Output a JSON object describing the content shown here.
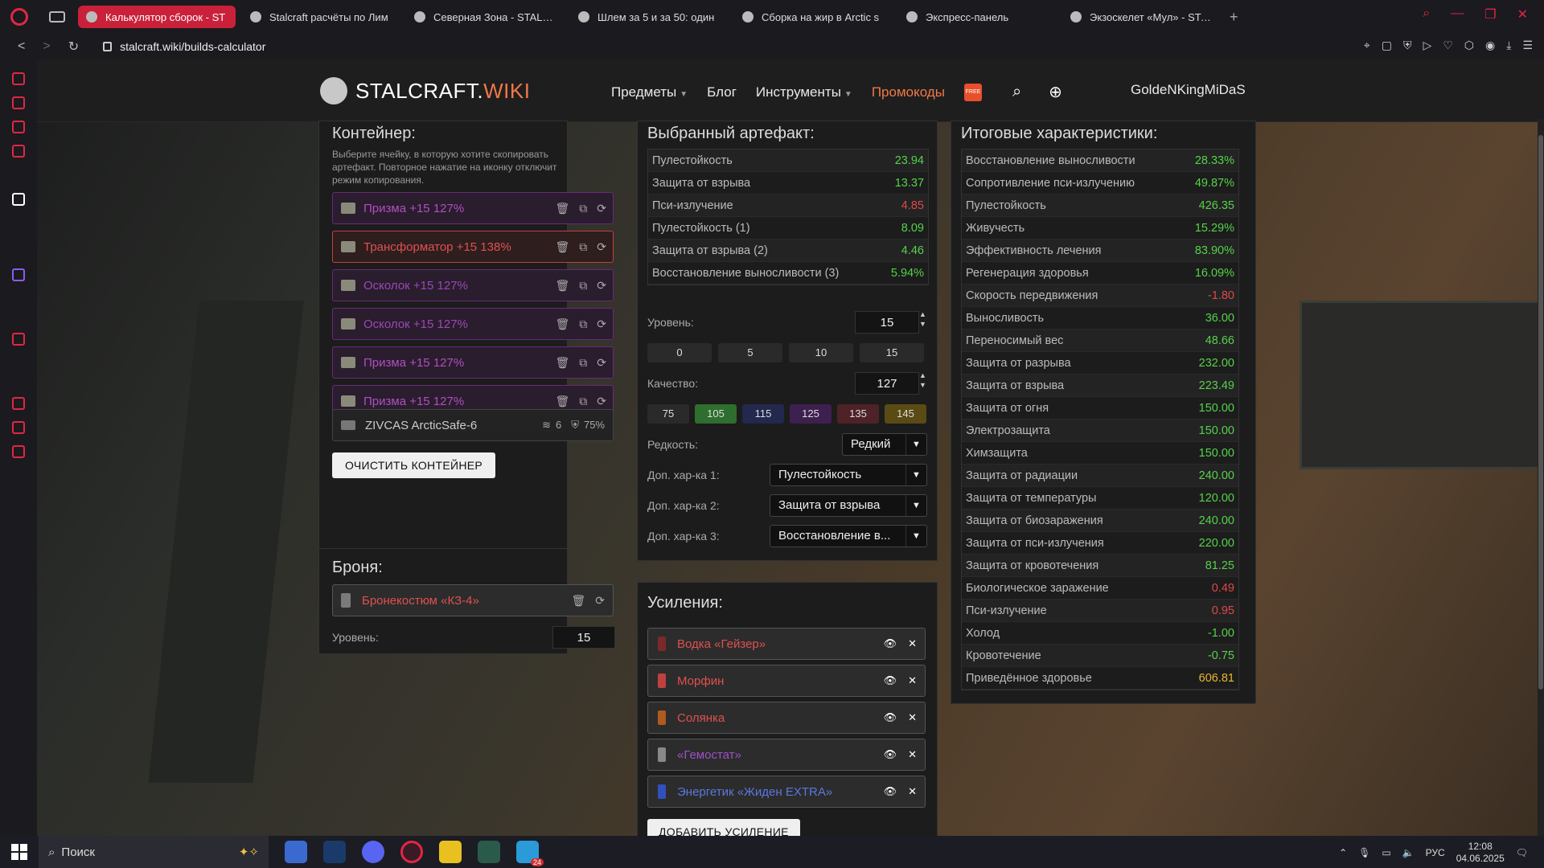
{
  "browser": {
    "tabs": [
      {
        "label": "Калькулятор сборок - ST",
        "active": true
      },
      {
        "label": "Stalcraft расчёты по Лим"
      },
      {
        "label": "Северная Зона - STALCR"
      },
      {
        "label": "Шлем за 5 и за 50: один"
      },
      {
        "label": "Сборка на жир в Arctic s"
      },
      {
        "label": "Экспресс-панель"
      },
      {
        "label": "Экзоскелет «Мул» - STAL"
      }
    ],
    "url": "stalcraft.wiki/builds-calculator",
    "accent": "#e02744"
  },
  "site": {
    "logo_main": "STALCRAFT.",
    "logo_accent": "WIKI",
    "menu": {
      "items": "Предметы",
      "blog": "Блог",
      "tools": "Инструменты",
      "promo": "Промокоды",
      "free_badge": "FREE"
    },
    "user": "GoldeNKingMiDaS"
  },
  "container": {
    "title": "Контейнер:",
    "hint": "Выберите ячейку, в которую хотите скопировать артефакт. Повторное нажатие на иконку отключит режим копирования.",
    "slots": [
      {
        "label": "Призма +15 127%"
      },
      {
        "label": "Трансформатор +15 138%"
      },
      {
        "label": "Осколок +15 127%"
      },
      {
        "label": "Осколок +15 127%"
      },
      {
        "label": "Призма +15 127%"
      },
      {
        "label": "Призма +15 127%"
      }
    ],
    "item": {
      "name": "ZIVCAS ArcticSafe-6",
      "slots": "6",
      "protection": "75%"
    },
    "clear_button": "ОЧИСТИТЬ КОНТЕЙНЕР"
  },
  "armor": {
    "title": "Броня:",
    "item": "Бронекостюм «КЗ-4»",
    "level_label": "Уровень:",
    "level": "15"
  },
  "artifact": {
    "title": "Выбранный артефакт:",
    "stats": [
      {
        "name": "Пулестойкость",
        "value": "23.94",
        "color": "g"
      },
      {
        "name": "Защита от взрыва",
        "value": "13.37",
        "color": "g"
      },
      {
        "name": "Пси-излучение",
        "value": "4.85",
        "color": "r"
      },
      {
        "name": "Пулестойкость (1)",
        "value": "8.09",
        "color": "g"
      },
      {
        "name": "Защита от взрыва (2)",
        "value": "4.46",
        "color": "g"
      },
      {
        "name": "Восстановление выносливости (3)",
        "value": "5.94%",
        "color": "g"
      }
    ],
    "level_label": "Уровень:",
    "level": "15",
    "level_quick": [
      "0",
      "5",
      "10",
      "15"
    ],
    "quality_label": "Качество:",
    "quality": "127",
    "quality_quick": [
      "75",
      "105",
      "115",
      "125",
      "135",
      "145"
    ],
    "quality_colors": [
      "#2a2a2a",
      "#2e6e2e",
      "#22284e",
      "#3e2050",
      "#4e2226",
      "#5a4a14"
    ],
    "rarity_label": "Редкость:",
    "rarity": "Редкий",
    "extra1_label": "Доп. хар-ка 1:",
    "extra1": "Пулестойкость",
    "extra2_label": "Доп. хар-ка 2:",
    "extra2": "Защита от взрыва",
    "extra3_label": "Доп. хар-ка 3:",
    "extra3": "Восстановление в..."
  },
  "boosts": {
    "title": "Усиления:",
    "items": [
      {
        "name": "Водка «Гейзер»",
        "color": "#e05050",
        "icon": "#7a2a2a"
      },
      {
        "name": "Морфин",
        "color": "#e05050",
        "icon": "#c04040"
      },
      {
        "name": "Солянка",
        "color": "#e05050",
        "icon": "#b05a20"
      },
      {
        "name": "«Гемостат»",
        "color": "#a050c8",
        "icon": "#888"
      },
      {
        "name": "Энергетик «Жиден EXTRA»",
        "color": "#5a78e0",
        "icon": "#3050c0"
      }
    ],
    "add_button": "ДОБАВИТЬ УСИЛЕНИЕ"
  },
  "total": {
    "title": "Итоговые характеристики:",
    "stats": [
      {
        "name": "Восстановление выносливости",
        "value": "28.33%",
        "color": "g"
      },
      {
        "name": "Сопротивление пси-излучению",
        "value": "49.87%",
        "color": "g"
      },
      {
        "name": "Пулестойкость",
        "value": "426.35",
        "color": "g"
      },
      {
        "name": "Живучесть",
        "value": "15.29%",
        "color": "g"
      },
      {
        "name": "Эффективность лечения",
        "value": "83.90%",
        "color": "g"
      },
      {
        "name": "Регенерация здоровья",
        "value": "16.09%",
        "color": "g"
      },
      {
        "name": "Скорость передвижения",
        "value": "-1.80",
        "color": "r"
      },
      {
        "name": "Выносливость",
        "value": "36.00",
        "color": "g"
      },
      {
        "name": "Переносимый вес",
        "value": "48.66",
        "color": "g"
      },
      {
        "name": "Защита от разрыва",
        "value": "232.00",
        "color": "g"
      },
      {
        "name": "Защита от взрыва",
        "value": "223.49",
        "color": "g"
      },
      {
        "name": "Защита от огня",
        "value": "150.00",
        "color": "g"
      },
      {
        "name": "Электрозащита",
        "value": "150.00",
        "color": "g"
      },
      {
        "name": "Химзащита",
        "value": "150.00",
        "color": "g"
      },
      {
        "name": "Защита от радиации",
        "value": "240.00",
        "color": "g"
      },
      {
        "name": "Защита от температуры",
        "value": "120.00",
        "color": "g"
      },
      {
        "name": "Защита от биозаражения",
        "value": "240.00",
        "color": "g"
      },
      {
        "name": "Защита от пси-излучения",
        "value": "220.00",
        "color": "g"
      },
      {
        "name": "Защита от кровотечения",
        "value": "81.25",
        "color": "g"
      },
      {
        "name": "Биологическое заражение",
        "value": "0.49",
        "color": "r"
      },
      {
        "name": "Пси-излучение",
        "value": "0.95",
        "color": "r"
      },
      {
        "name": "Холод",
        "value": "-1.00",
        "color": "g"
      },
      {
        "name": "Кровотечение",
        "value": "-0.75",
        "color": "g"
      },
      {
        "name": "Приведённое здоровье",
        "value": "606.81",
        "color": "y"
      }
    ]
  },
  "taskbar": {
    "search_placeholder": "Поиск",
    "lang": "РУС",
    "time": "12:08",
    "date": "04.06.2025",
    "telegram_badge": "24"
  }
}
